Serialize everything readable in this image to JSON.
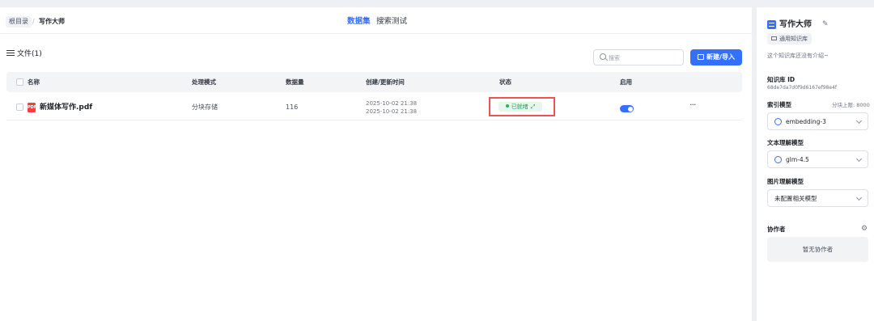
{
  "breadcrumb": {
    "root": "根目录",
    "separator": "/",
    "current": "写作大师"
  },
  "tabs": [
    {
      "label": "数据集",
      "active": true
    },
    {
      "label": "搜索测试",
      "active": false
    }
  ],
  "files_header": {
    "title": "文件(1)"
  },
  "search": {
    "placeholder": "搜索",
    "value": ""
  },
  "new_button": {
    "label": "新建/导入"
  },
  "table": {
    "columns": [
      "名称",
      "处理模式",
      "数据量",
      "创建/更新时间",
      "状态",
      "启用"
    ],
    "rows": [
      {
        "name": "新媒体写作.pdf",
        "file_type": "PDF",
        "mode": "分块存储",
        "count": "116",
        "created": "2025-10-02 21:38",
        "updated": "2025-10-02 21:38",
        "status": "已就绪",
        "enabled": true,
        "more": "···"
      }
    ]
  },
  "side": {
    "title": "写作大师",
    "type_label": "通用知识库",
    "description": "这个知识库还没有介绍~",
    "id_label": "知识库 ID",
    "id_value": "68de7da7d0f9d6167ef98e4f",
    "index_model_label": "索引模型",
    "chunk_limit": "分块上限: 8000",
    "index_model": "embedding-3",
    "text_model_label": "文本理解模型",
    "text_model": "glm-4.5",
    "image_model_label": "图片理解模型",
    "image_model": "未配置相关模型",
    "collaborators_label": "协作者",
    "collaborators_empty": "暂无协作者"
  },
  "colors": {
    "accent": "#3370ff",
    "status_ready": "#1f9d55",
    "highlight_border": "#f05252"
  }
}
